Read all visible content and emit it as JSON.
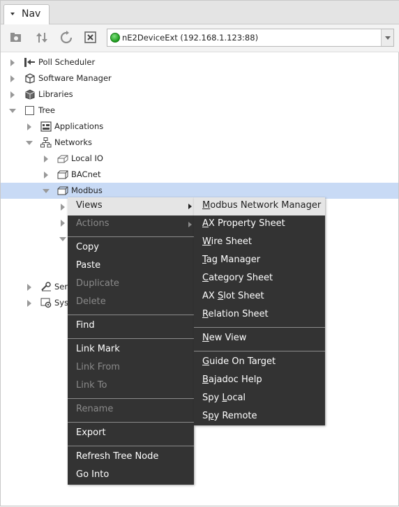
{
  "tab": {
    "label": "Nav"
  },
  "toolbar": {
    "ord_text": "nE2DeviceExt (192.168.1.123:88)",
    "status_color": "#2eb82e"
  },
  "tree": {
    "items": [
      {
        "label": "Poll Scheduler",
        "icon": "poll-scheduler-icon"
      },
      {
        "label": "Software Manager",
        "icon": "software-manager-icon"
      },
      {
        "label": "Libraries",
        "icon": "libraries-icon"
      },
      {
        "label": "Tree",
        "icon": "tree-icon"
      },
      {
        "label": "Applications",
        "icon": "applications-icon"
      },
      {
        "label": "Networks",
        "icon": "networks-icon"
      },
      {
        "label": "Local IO",
        "icon": "local-io-icon"
      },
      {
        "label": "BACnet",
        "icon": "bacnet-icon"
      },
      {
        "label": "Modbus",
        "icon": "modbus-icon"
      },
      {
        "label": "Serv",
        "icon": "services-icon"
      },
      {
        "label": "Syst",
        "icon": "system-icon"
      }
    ]
  },
  "context_menu": {
    "items": [
      {
        "label": "Views",
        "enabled": true,
        "submenu": true
      },
      {
        "label": "Actions",
        "enabled": false,
        "submenu": true
      },
      {
        "label": "Copy",
        "enabled": true
      },
      {
        "label": "Paste",
        "enabled": true
      },
      {
        "label": "Duplicate",
        "enabled": false
      },
      {
        "label": "Delete",
        "enabled": false
      },
      {
        "label": "Find",
        "enabled": true
      },
      {
        "label": "Link Mark",
        "enabled": true
      },
      {
        "label": "Link From",
        "enabled": false
      },
      {
        "label": "Link To",
        "enabled": false
      },
      {
        "label": "Rename",
        "enabled": false
      },
      {
        "label": "Export",
        "enabled": true
      },
      {
        "label": "Refresh Tree Node",
        "enabled": true
      },
      {
        "label": "Go Into",
        "enabled": true
      }
    ]
  },
  "views_submenu": {
    "items": [
      {
        "label": "Modbus Network Manager",
        "mnemonic": "M"
      },
      {
        "label": "AX Property Sheet",
        "mnemonic": "A"
      },
      {
        "label": "Wire Sheet",
        "mnemonic": "W"
      },
      {
        "label": "Tag Manager",
        "mnemonic": "T"
      },
      {
        "label": "Category Sheet",
        "mnemonic": "C"
      },
      {
        "label": "AX Slot Sheet",
        "mnemonic": "S"
      },
      {
        "label": "Relation Sheet",
        "mnemonic": "R"
      },
      {
        "label": "New View",
        "mnemonic": "N"
      },
      {
        "label": "Guide On Target",
        "mnemonic": "G"
      },
      {
        "label": "Bajadoc Help",
        "mnemonic": "B"
      },
      {
        "label": "Spy Local",
        "mnemonic": "L"
      },
      {
        "label": "Spy Remote",
        "mnemonic": "p"
      }
    ]
  }
}
